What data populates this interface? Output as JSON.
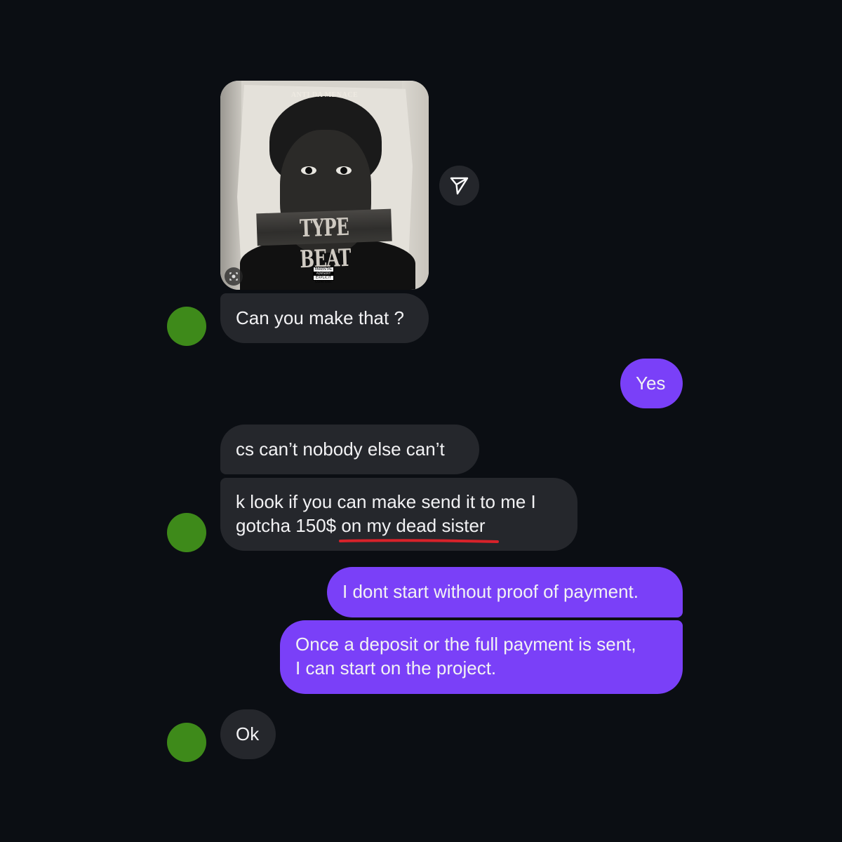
{
  "shared_post": {
    "album_title": "ANTI DA MENACE",
    "tape_text": "TYPE BEAT",
    "advisory_top": "PARENTAL",
    "advisory_mid": "ADVISORY",
    "advisory_bottom": "EXPLICIT CONTENT"
  },
  "messages": [
    {
      "from": "them",
      "text": "Can you make that ?"
    },
    {
      "from": "me",
      "text": "Yes"
    },
    {
      "from": "them",
      "text": "cs can’t nobody else can’t"
    },
    {
      "from": "them",
      "text": "k look if you can make send it to me I\ngotcha 150$ on my dead sister"
    },
    {
      "from": "me",
      "text": "I dont start without proof of payment."
    },
    {
      "from": "me",
      "text": "Once a deposit or the full payment is sent,\nI can start on the project."
    },
    {
      "from": "them",
      "text": "Ok"
    }
  ],
  "colors": {
    "background": "#0b0e13",
    "incoming_bubble": "#25272c",
    "outgoing_bubble": "#7a40f8",
    "avatar": "#3e8a1a",
    "annotation_underline": "#d8222a"
  },
  "icons": [
    "send-icon",
    "visual-search-icon"
  ]
}
